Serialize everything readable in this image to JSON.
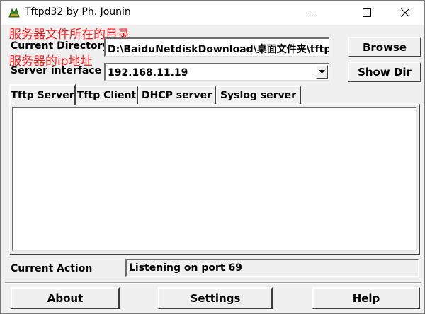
{
  "window": {
    "title": "Tftpd32 by Ph. Jounin"
  },
  "annotations": {
    "directory_note": "服务器文件所在的目录",
    "interface_note": "服务器的ip地址"
  },
  "form": {
    "current_directory_label": "Current Directory",
    "current_directory_value": "D:\\BaiduNetdiskDownload\\桌面文件夹\\tftp",
    "server_interface_label": "Server interface",
    "server_interface_value": "192.168.11.19",
    "browse_label": "Browse",
    "show_dir_label": "Show Dir"
  },
  "tabs": [
    {
      "label": "Tftp Server",
      "active": true
    },
    {
      "label": "Tftp Client",
      "active": false
    },
    {
      "label": "DHCP server",
      "active": false
    },
    {
      "label": "Syslog server",
      "active": false
    }
  ],
  "status": {
    "current_action_label": "Current Action",
    "current_action_value": "Listening on port 69"
  },
  "footer": {
    "about_label": "About",
    "settings_label": "Settings",
    "help_label": "Help"
  },
  "colors": {
    "annotation": "#ff1a1a",
    "face": "#f0f0f0"
  },
  "icons": {
    "app": "tftpd-app-icon",
    "minimize": "minimize-icon",
    "maximize": "maximize-icon",
    "close": "close-icon",
    "dropdown": "chevron-down-icon"
  }
}
